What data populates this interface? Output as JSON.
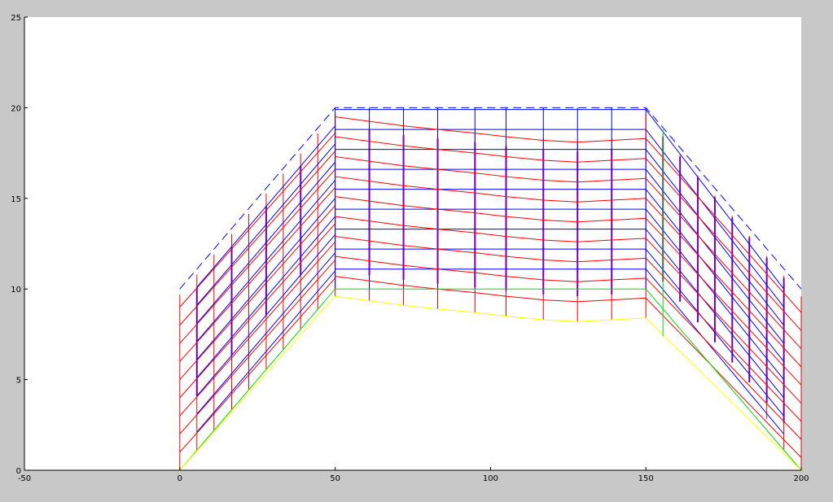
{
  "chart_data": {
    "type": "line",
    "title": "",
    "xlabel": "",
    "ylabel": "",
    "xlim": [
      -50,
      200
    ],
    "ylim": [
      0,
      25
    ],
    "grid": false,
    "x_ticks": [
      -50,
      0,
      50,
      100,
      150,
      200
    ],
    "x_tick_labels": [
      "-50",
      "0",
      "50",
      "100",
      "150",
      "200"
    ],
    "y_ticks": [
      0,
      5,
      10,
      15,
      20,
      25
    ],
    "y_tick_labels": [
      "0",
      "5",
      "10",
      "15",
      "20",
      "25"
    ],
    "colors": {
      "background": "#c8c8c8",
      "axes": "#ffffff",
      "red": "#ff0000",
      "blue": "#0000ff",
      "green": "#00dd00",
      "yellow": "#ffff00",
      "purple": "#7700aa"
    },
    "series": [
      {
        "color": "blue",
        "style": "dashed",
        "x": [
          0,
          50,
          150,
          200
        ],
        "y": [
          10,
          20,
          20,
          10
        ]
      },
      {
        "color": "green",
        "style": "solid",
        "x": [
          0,
          50,
          150,
          200
        ],
        "y": [
          0,
          10,
          10,
          0
        ]
      },
      {
        "color": "yellow",
        "style": "solid",
        "x": [
          0,
          50,
          72,
          83,
          95,
          105,
          117,
          128,
          139,
          150,
          200
        ],
        "y": [
          0,
          9.6,
          9.1,
          8.9,
          8.7,
          8.5,
          8.3,
          8.2,
          8.3,
          8.4,
          0
        ]
      }
    ]
  }
}
